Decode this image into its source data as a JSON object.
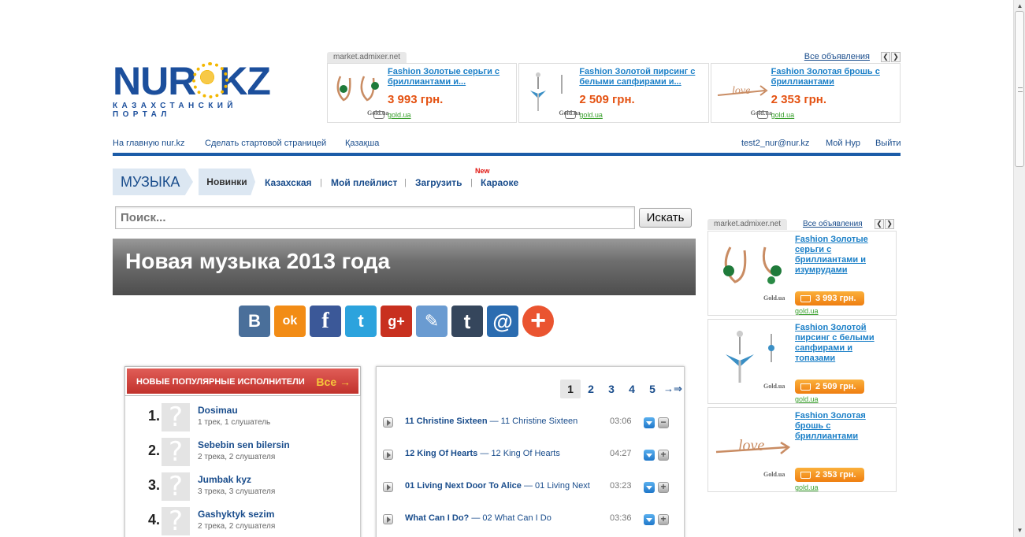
{
  "logo": {
    "part1": "NUR",
    "part2": "KZ",
    "tagline": "КАЗАХСТАНСКИЙ ПОРТАЛ"
  },
  "top_ads": {
    "source": "market.admixer.net",
    "all_link": "Все объявления",
    "items": [
      {
        "title": "Fashion Золотые серьги с бриллиантами и...",
        "price": "3 993 грн.",
        "shop": "gold.ua",
        "image_icon": "earrings-icon",
        "brand": "Gold.ua"
      },
      {
        "title": "Fashion Золотой пирсинг с белыми сапфирами и...",
        "price": "2 509 грн.",
        "shop": "gold.ua",
        "image_icon": "piercing-icon",
        "brand": "Gold.ua"
      },
      {
        "title": "Fashion Золотая брошь с бриллиантами",
        "price": "2 353 грн.",
        "shop": "gold.ua",
        "image_icon": "brooch-icon",
        "brand": "Gold.ua"
      }
    ]
  },
  "topnav": {
    "home": "На главную nur.kz",
    "start_page": "Сделать стартовой страницей",
    "kazakh": "Қазақша",
    "user_email": "test2_nur@nur.kz",
    "my_nur": "Мой Нур",
    "logout": "Выйти"
  },
  "section": {
    "label": "МУЗЫКА",
    "tabs": [
      "Новинки",
      "Казахская",
      "Мой плейлист",
      "Загрузить",
      "Караоке"
    ],
    "new_badge": "New"
  },
  "search": {
    "placeholder": "Поиск...",
    "button": "Искать"
  },
  "banner_title": "Новая музыка 2013 года",
  "share_buttons": [
    {
      "name": "vkontakte",
      "glyph": "В",
      "color": "#4a6f9a"
    },
    {
      "name": "odnoklassniki",
      "glyph": "ok",
      "color": "#f28c16"
    },
    {
      "name": "facebook",
      "glyph": "f",
      "color": "#3b5898"
    },
    {
      "name": "twitter",
      "glyph": "t",
      "color": "#2ca3dd"
    },
    {
      "name": "google-plus",
      "glyph": "g+",
      "color": "#c8301f"
    },
    {
      "name": "livejournal",
      "glyph": "✎",
      "color": "#6a9bd1"
    },
    {
      "name": "tumblr",
      "glyph": "t",
      "color": "#35465c"
    },
    {
      "name": "mail-ru",
      "glyph": "@",
      "color": "#2b6cb0"
    },
    {
      "name": "more",
      "glyph": "+",
      "color": "#ea5430"
    }
  ],
  "artists": {
    "title": "НОВЫЕ ПОПУЛЯРНЫЕ ИСПОЛНИТЕЛИ",
    "all_link": "Все →",
    "items": [
      {
        "num": "1.",
        "name": "Dosimau",
        "stats": "1 трек, 1 слушатель"
      },
      {
        "num": "2.",
        "name": "Sebebin sen bilersin",
        "stats": "2 трека, 2 слушателя"
      },
      {
        "num": "3.",
        "name": "Jumbak kyz",
        "stats": "3 трека, 3 слушателя"
      },
      {
        "num": "4.",
        "name": "Gashyktyk sezim",
        "stats": "2 трека, 2 слушателя"
      }
    ]
  },
  "tracks": {
    "pages": [
      "1",
      "2",
      "3",
      "4",
      "5"
    ],
    "current_page": "1",
    "next": "→⇒",
    "items": [
      {
        "artist": "11 Christine Sixteen",
        "title": "11 Christine Sixteen",
        "duration": "03:06",
        "action": "−"
      },
      {
        "artist": "12 King Of Hearts",
        "title": "12 King Of Hearts",
        "duration": "04:27",
        "action": "+"
      },
      {
        "artist": "01 Living Next Door To Alice",
        "title": "01 Living Next",
        "duration": "03:23",
        "action": "+"
      },
      {
        "artist": "What Can I Do?",
        "title": "02 What Can I Do",
        "duration": "03:36",
        "action": "+"
      }
    ]
  },
  "right_ads": {
    "source": "market.admixer.net",
    "all_link": "Все объявления",
    "items": [
      {
        "title": "Fashion Золотые серьги с бриллиантами и изумрудами",
        "price": "3 993 грн.",
        "shop": "gold.ua",
        "image_icon": "earrings-icon",
        "brand": "Gold.ua"
      },
      {
        "title": "Fashion Золотой пирсинг с белыми сапфирами и топазами",
        "price": "2 509 грн.",
        "shop": "gold.ua",
        "image_icon": "piercing-icon",
        "brand": "Gold.ua"
      },
      {
        "title": "Fashion Золотая брошь с бриллиантами",
        "price": "2 353 грн.",
        "shop": "gold.ua",
        "image_icon": "brooch-icon",
        "brand": "Gold.ua"
      }
    ]
  }
}
